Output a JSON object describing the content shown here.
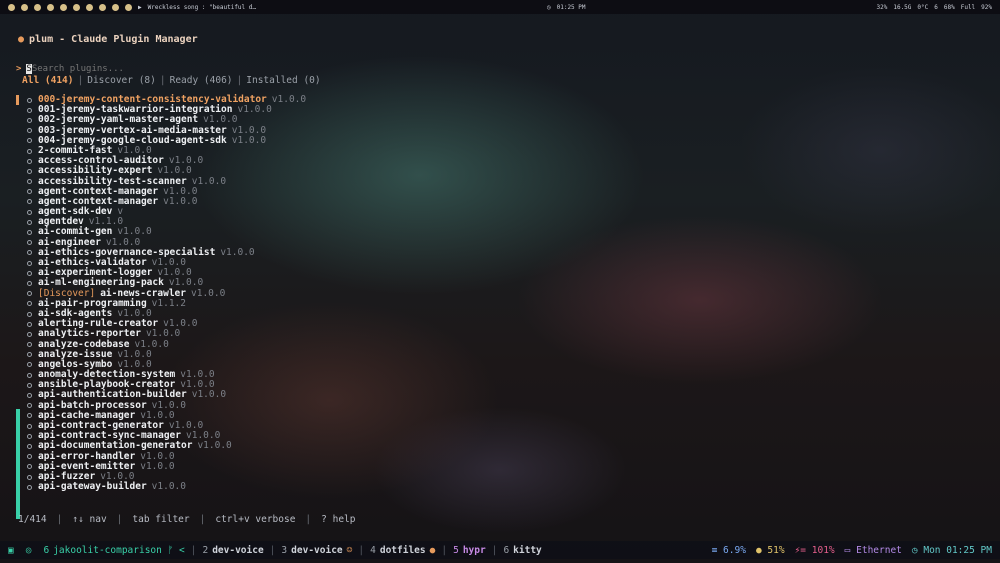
{
  "topbar": {
    "song": "Wreckless song : \"beautiful d…",
    "time": "01:25 PM",
    "cpu": "32%",
    "temp": "0°C",
    "gpu": "16.5G",
    "cpu2": "6",
    "mem": "68%",
    "display": "Full",
    "battery": "92%"
  },
  "app": {
    "title": "plum - Claude Plugin Manager",
    "search_placeholder": "Search plugins...",
    "tabs": [
      {
        "label": "All (414)"
      },
      {
        "label": "Discover (8)"
      },
      {
        "label": "Ready (406)"
      },
      {
        "label": "Installed (0)"
      }
    ]
  },
  "plugins": [
    {
      "tag": "",
      "name": "000-jeremy-content-consistency-validator",
      "version": "v1.0.0"
    },
    {
      "tag": "",
      "name": "001-jeremy-taskwarrior-integration",
      "version": "v1.0.0"
    },
    {
      "tag": "",
      "name": "002-jeremy-yaml-master-agent",
      "version": "v1.0.0"
    },
    {
      "tag": "",
      "name": "003-jeremy-vertex-ai-media-master",
      "version": "v1.0.0"
    },
    {
      "tag": "",
      "name": "004-jeremy-google-cloud-agent-sdk",
      "version": "v1.0.0"
    },
    {
      "tag": "",
      "name": "2-commit-fast",
      "version": "v1.0.0"
    },
    {
      "tag": "",
      "name": "access-control-auditor",
      "version": "v1.0.0"
    },
    {
      "tag": "",
      "name": "accessibility-expert",
      "version": "v1.0.0"
    },
    {
      "tag": "",
      "name": "accessibility-test-scanner",
      "version": "v1.0.0"
    },
    {
      "tag": "",
      "name": "agent-context-manager",
      "version": "v1.0.0"
    },
    {
      "tag": "",
      "name": "agent-context-manager",
      "version": "v1.0.0"
    },
    {
      "tag": "",
      "name": "agent-sdk-dev",
      "version": "v"
    },
    {
      "tag": "",
      "name": "agentdev",
      "version": "v1.1.0"
    },
    {
      "tag": "",
      "name": "ai-commit-gen",
      "version": "v1.0.0"
    },
    {
      "tag": "",
      "name": "ai-engineer",
      "version": "v1.0.0"
    },
    {
      "tag": "",
      "name": "ai-ethics-governance-specialist",
      "version": "v1.0.0"
    },
    {
      "tag": "",
      "name": "ai-ethics-validator",
      "version": "v1.0.0"
    },
    {
      "tag": "",
      "name": "ai-experiment-logger",
      "version": "v1.0.0"
    },
    {
      "tag": "",
      "name": "ai-ml-engineering-pack",
      "version": "v1.0.0"
    },
    {
      "tag": "[Discover]",
      "name": "ai-news-crawler",
      "version": "v1.0.0"
    },
    {
      "tag": "",
      "name": "ai-pair-programming",
      "version": "v1.1.2"
    },
    {
      "tag": "",
      "name": "ai-sdk-agents",
      "version": "v1.0.0"
    },
    {
      "tag": "",
      "name": "alerting-rule-creator",
      "version": "v1.0.0"
    },
    {
      "tag": "",
      "name": "analytics-reporter",
      "version": "v1.0.0"
    },
    {
      "tag": "",
      "name": "analyze-codebase",
      "version": "v1.0.0"
    },
    {
      "tag": "",
      "name": "analyze-issue",
      "version": "v1.0.0"
    },
    {
      "tag": "",
      "name": "angelos-symbo",
      "version": "v1.0.0"
    },
    {
      "tag": "",
      "name": "anomaly-detection-system",
      "version": "v1.0.0"
    },
    {
      "tag": "",
      "name": "ansible-playbook-creator",
      "version": "v1.0.0"
    },
    {
      "tag": "",
      "name": "api-authentication-builder",
      "version": "v1.0.0"
    },
    {
      "tag": "",
      "name": "api-batch-processor",
      "version": "v1.0.0"
    },
    {
      "tag": "",
      "name": "api-cache-manager",
      "version": "v1.0.0"
    },
    {
      "tag": "",
      "name": "api-contract-generator",
      "version": "v1.0.0"
    },
    {
      "tag": "",
      "name": "api-contract-sync-manager",
      "version": "v1.0.0"
    },
    {
      "tag": "",
      "name": "api-documentation-generator",
      "version": "v1.0.0"
    },
    {
      "tag": "",
      "name": "api-error-handler",
      "version": "v1.0.0"
    },
    {
      "tag": "",
      "name": "api-event-emitter",
      "version": "v1.0.0"
    },
    {
      "tag": "",
      "name": "api-fuzzer",
      "version": "v1.0.0"
    },
    {
      "tag": "",
      "name": "api-gateway-builder",
      "version": "v1.0.0"
    }
  ],
  "statusbar": {
    "position": "1/414",
    "nav": "↑↓ nav",
    "filter": "tab filter",
    "verbose": "ctrl+v verbose",
    "help": "? help"
  },
  "bottombar": {
    "workspaces": [
      {
        "num": "6",
        "label": "jakoolit-comparison ᚠ <"
      },
      {
        "num": "2",
        "label": "dev-voice"
      },
      {
        "num": "3",
        "label": "dev-voice"
      },
      {
        "num": "4",
        "label": "dotfiles"
      },
      {
        "num": "5",
        "label": "hypr"
      },
      {
        "num": "6",
        "label": "kitty"
      }
    ],
    "cpu": "6.9%",
    "brightness": "51%",
    "battery": "101%",
    "network": "Ethernet",
    "clock": "Mon 01:25 PM"
  }
}
